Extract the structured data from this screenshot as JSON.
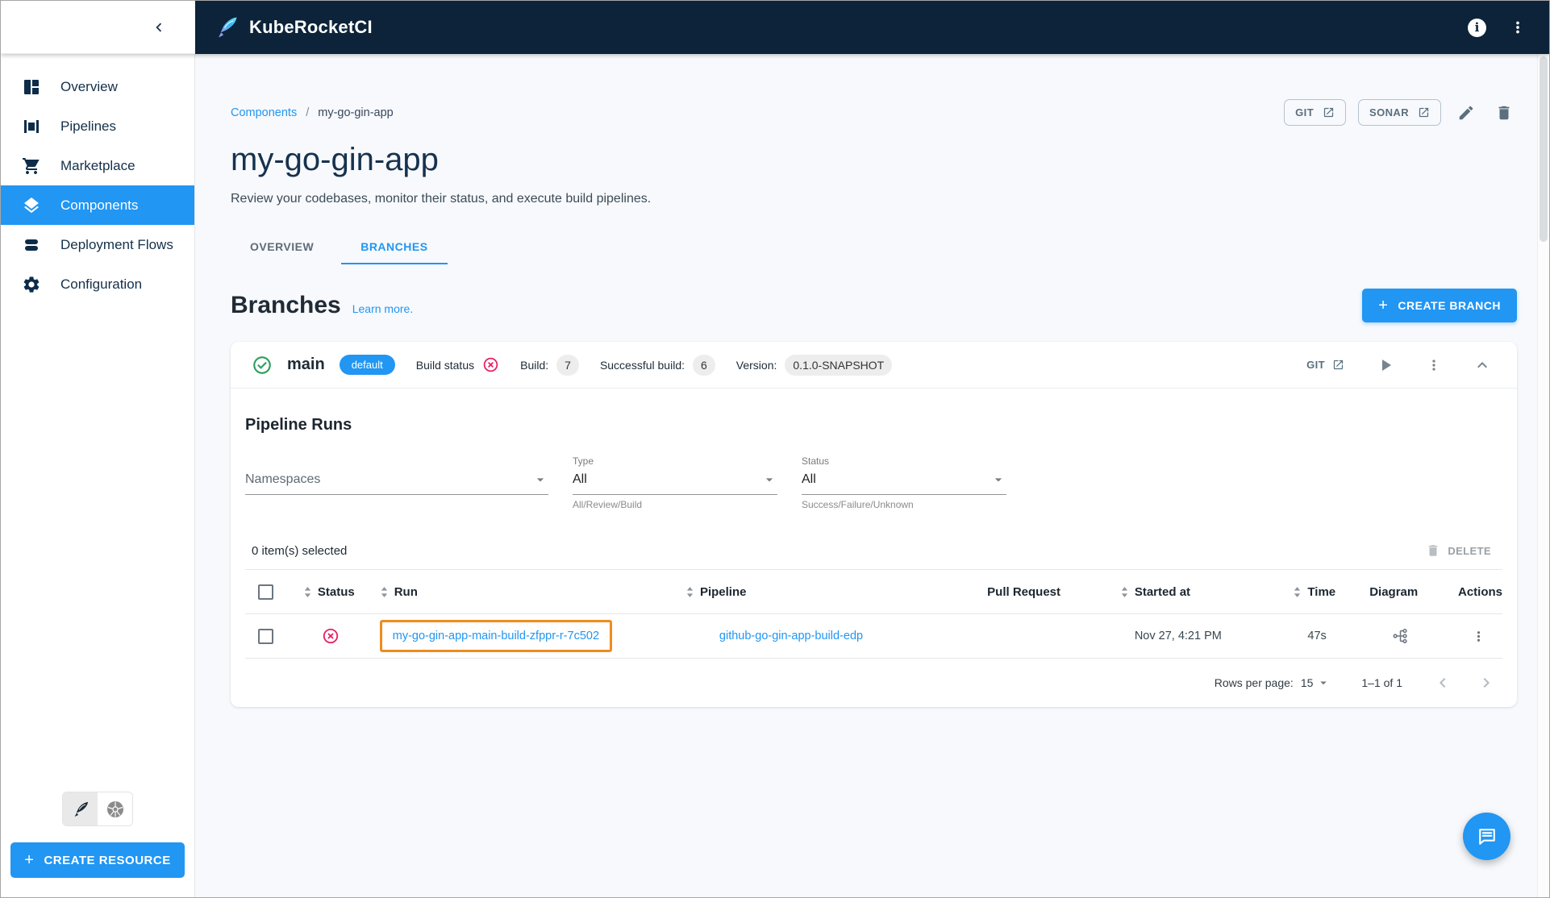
{
  "icons": {
    "plus": "+",
    "info": "i"
  },
  "colors": {
    "accent_blue": "#2196F3",
    "header_navy": "#0C2339",
    "success_green": "#2E9E5E",
    "error_red": "#E91E63",
    "annotation_orange": "#F08B1E",
    "chip_gray": "#EDEDED",
    "page_bg": "#F7F9FC"
  },
  "header": {
    "app_title": "KubeRocketCI"
  },
  "sidebar": {
    "items": [
      {
        "label": "Overview"
      },
      {
        "label": "Pipelines"
      },
      {
        "label": "Marketplace"
      },
      {
        "label": "Components"
      },
      {
        "label": "Deployment Flows"
      },
      {
        "label": "Configuration"
      }
    ],
    "create_resource_label": "CREATE RESOURCE"
  },
  "breadcrumb": {
    "parent": "Components",
    "separator": "/",
    "current": "my-go-gin-app"
  },
  "page": {
    "title": "my-go-gin-app",
    "description": "Review your codebases, monitor their status, and execute build pipelines.",
    "actions": {
      "git_label": "GIT",
      "sonar_label": "SONAR"
    }
  },
  "tabs": [
    {
      "label": "OVERVIEW"
    },
    {
      "label": "BRANCHES"
    }
  ],
  "branches_section": {
    "heading": "Branches",
    "learn_more_label": "Learn more.",
    "create_branch_label": "CREATE BRANCH"
  },
  "branch": {
    "name": "main",
    "default_badge": "default",
    "build_status_label": "Build status",
    "build_label": "Build:",
    "build_count": "7",
    "successful_build_label": "Successful build:",
    "successful_build_count": "6",
    "version_label": "Version:",
    "version_value": "0.1.0-SNAPSHOT",
    "git_label": "GIT"
  },
  "pipeline_runs": {
    "heading": "Pipeline Runs",
    "filters": {
      "namespaces_placeholder": "Namespaces",
      "type_label": "Type",
      "type_value": "All",
      "type_helper": "All/Review/Build",
      "status_label": "Status",
      "status_value": "All",
      "status_helper": "Success/Failure/Unknown"
    },
    "selected_text": "0 item(s) selected",
    "delete_label": "DELETE",
    "table": {
      "columns": [
        "Status",
        "Run",
        "Pipeline",
        "Pull Request",
        "Started at",
        "Time",
        "Diagram",
        "Actions"
      ],
      "rows": [
        {
          "status": "failed",
          "run": "my-go-gin-app-main-build-zfppr-r-7c502",
          "pipeline": "github-go-gin-app-build-edp",
          "pull_request": "",
          "started_at": "Nov 27, 4:21 PM",
          "time": "47s"
        }
      ]
    },
    "pagination": {
      "rows_per_page_label": "Rows per page:",
      "rows_per_page_value": "15",
      "range_text": "1–1 of 1"
    }
  }
}
